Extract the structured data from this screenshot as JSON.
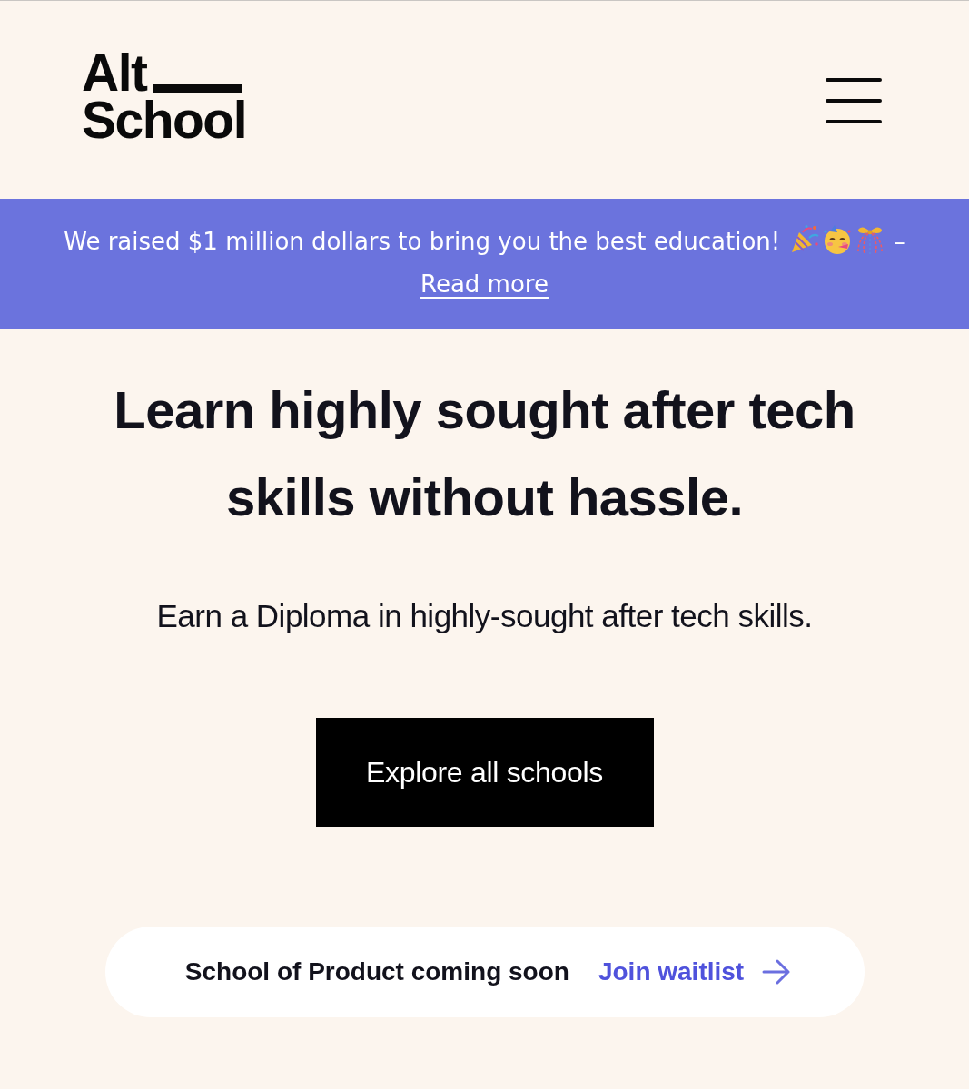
{
  "header": {
    "logo": {
      "line_1": "Alt",
      "line_2": "School"
    }
  },
  "announcement": {
    "text": "We raised $1 million dollars to bring you the best education!",
    "dash": "–",
    "link": "Read more"
  },
  "hero": {
    "headline": "Learn highly sought after tech skills without hassle.",
    "subtitle": "Earn a Diploma in highly-sought after tech skills.",
    "button": "Explore all schools"
  },
  "notice": {
    "text": "School of Product coming soon",
    "link": "Join waitlist"
  }
}
